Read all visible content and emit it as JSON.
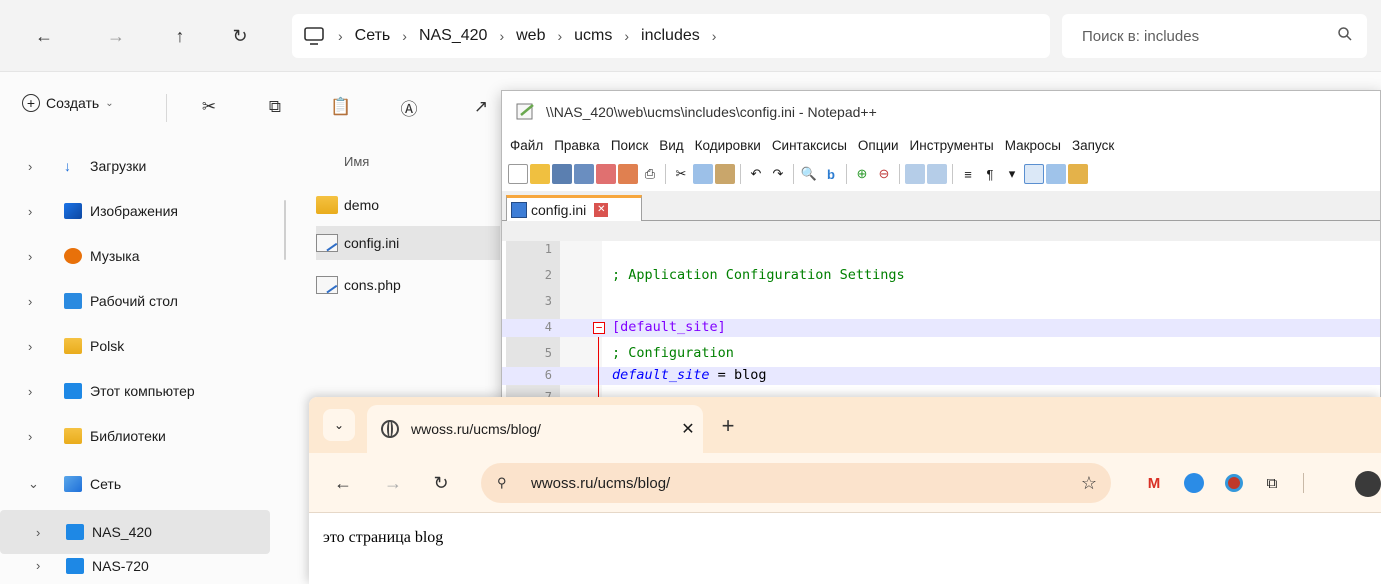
{
  "explorer": {
    "breadcrumbs": [
      "Сеть",
      "NAS_420",
      "web",
      "ucms",
      "includes"
    ],
    "search_placeholder": "Поиск в: includes",
    "toolbar": {
      "create_label": "Создать"
    },
    "nav_items": [
      {
        "label": "Загрузки",
        "icon": "download-icon"
      },
      {
        "label": "Изображения",
        "icon": "pictures-icon"
      },
      {
        "label": "Музыка",
        "icon": "music-icon"
      },
      {
        "label": "Рабочий стол",
        "icon": "desktop-icon"
      },
      {
        "label": "Polsk",
        "icon": "folder-icon"
      },
      {
        "label": "Этот компьютер",
        "icon": "computer-icon"
      },
      {
        "label": "Библиотеки",
        "icon": "folder-icon"
      },
      {
        "label": "Сеть",
        "icon": "network-icon"
      },
      {
        "label": "NAS_420",
        "icon": "computer-icon"
      },
      {
        "label": "NAS-720",
        "icon": "computer-icon"
      }
    ],
    "column_name": "Имя",
    "files": [
      {
        "name": "demo",
        "type": "folder"
      },
      {
        "name": "config.ini",
        "type": "file"
      },
      {
        "name": "cons.php",
        "type": "file"
      }
    ]
  },
  "notepad": {
    "title": "\\\\NAS_420\\web\\ucms\\includes\\config.ini - Notepad++",
    "menu": [
      "Файл",
      "Правка",
      "Поиск",
      "Вид",
      "Кодировки",
      "Синтаксисы",
      "Опции",
      "Инструменты",
      "Макросы",
      "Запуск"
    ],
    "tab_label": "config.ini",
    "lines": [
      {
        "n": "1",
        "text": ""
      },
      {
        "n": "2",
        "text": "; Application Configuration Settings"
      },
      {
        "n": "3",
        "text": ""
      },
      {
        "n": "4",
        "text": "[default_site]"
      },
      {
        "n": "5",
        "text": "; Configuration"
      },
      {
        "n": "6",
        "key": "default_site",
        "eq": " = ",
        "value": "blog"
      },
      {
        "n": "7",
        "text": ""
      }
    ]
  },
  "browser": {
    "tab_title": "wwoss.ru/ucms/blog/",
    "url": "wwoss.ru/ucms/blog/",
    "page_text": "это страница blog"
  },
  "colors": {
    "npp_tab_accent": "#f7a73e",
    "browser_tabstrip": "#fde9d2",
    "browser_toolbar": "#fff6eb",
    "code_comment": "#008000",
    "code_section": "#8000ff",
    "code_key": "#0000ff"
  }
}
